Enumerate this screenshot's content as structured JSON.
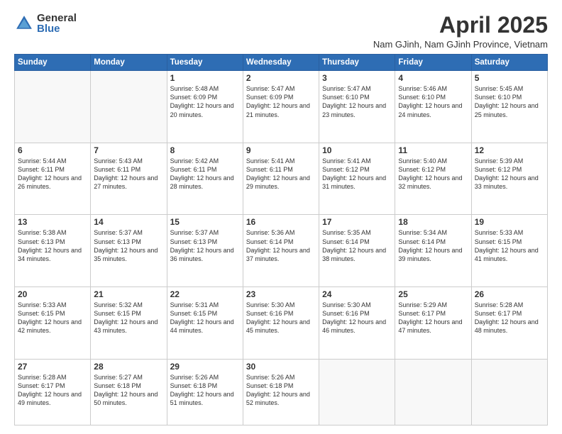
{
  "logo": {
    "general": "General",
    "blue": "Blue"
  },
  "header": {
    "title": "April 2025",
    "location": "Nam GJinh, Nam GJinh Province, Vietnam"
  },
  "weekdays": [
    "Sunday",
    "Monday",
    "Tuesday",
    "Wednesday",
    "Thursday",
    "Friday",
    "Saturday"
  ],
  "weeks": [
    [
      {
        "day": "",
        "info": ""
      },
      {
        "day": "",
        "info": ""
      },
      {
        "day": "1",
        "info": "Sunrise: 5:48 AM\nSunset: 6:09 PM\nDaylight: 12 hours and 20 minutes."
      },
      {
        "day": "2",
        "info": "Sunrise: 5:47 AM\nSunset: 6:09 PM\nDaylight: 12 hours and 21 minutes."
      },
      {
        "day": "3",
        "info": "Sunrise: 5:47 AM\nSunset: 6:10 PM\nDaylight: 12 hours and 23 minutes."
      },
      {
        "day": "4",
        "info": "Sunrise: 5:46 AM\nSunset: 6:10 PM\nDaylight: 12 hours and 24 minutes."
      },
      {
        "day": "5",
        "info": "Sunrise: 5:45 AM\nSunset: 6:10 PM\nDaylight: 12 hours and 25 minutes."
      }
    ],
    [
      {
        "day": "6",
        "info": "Sunrise: 5:44 AM\nSunset: 6:11 PM\nDaylight: 12 hours and 26 minutes."
      },
      {
        "day": "7",
        "info": "Sunrise: 5:43 AM\nSunset: 6:11 PM\nDaylight: 12 hours and 27 minutes."
      },
      {
        "day": "8",
        "info": "Sunrise: 5:42 AM\nSunset: 6:11 PM\nDaylight: 12 hours and 28 minutes."
      },
      {
        "day": "9",
        "info": "Sunrise: 5:41 AM\nSunset: 6:11 PM\nDaylight: 12 hours and 29 minutes."
      },
      {
        "day": "10",
        "info": "Sunrise: 5:41 AM\nSunset: 6:12 PM\nDaylight: 12 hours and 31 minutes."
      },
      {
        "day": "11",
        "info": "Sunrise: 5:40 AM\nSunset: 6:12 PM\nDaylight: 12 hours and 32 minutes."
      },
      {
        "day": "12",
        "info": "Sunrise: 5:39 AM\nSunset: 6:12 PM\nDaylight: 12 hours and 33 minutes."
      }
    ],
    [
      {
        "day": "13",
        "info": "Sunrise: 5:38 AM\nSunset: 6:13 PM\nDaylight: 12 hours and 34 minutes."
      },
      {
        "day": "14",
        "info": "Sunrise: 5:37 AM\nSunset: 6:13 PM\nDaylight: 12 hours and 35 minutes."
      },
      {
        "day": "15",
        "info": "Sunrise: 5:37 AM\nSunset: 6:13 PM\nDaylight: 12 hours and 36 minutes."
      },
      {
        "day": "16",
        "info": "Sunrise: 5:36 AM\nSunset: 6:14 PM\nDaylight: 12 hours and 37 minutes."
      },
      {
        "day": "17",
        "info": "Sunrise: 5:35 AM\nSunset: 6:14 PM\nDaylight: 12 hours and 38 minutes."
      },
      {
        "day": "18",
        "info": "Sunrise: 5:34 AM\nSunset: 6:14 PM\nDaylight: 12 hours and 39 minutes."
      },
      {
        "day": "19",
        "info": "Sunrise: 5:33 AM\nSunset: 6:15 PM\nDaylight: 12 hours and 41 minutes."
      }
    ],
    [
      {
        "day": "20",
        "info": "Sunrise: 5:33 AM\nSunset: 6:15 PM\nDaylight: 12 hours and 42 minutes."
      },
      {
        "day": "21",
        "info": "Sunrise: 5:32 AM\nSunset: 6:15 PM\nDaylight: 12 hours and 43 minutes."
      },
      {
        "day": "22",
        "info": "Sunrise: 5:31 AM\nSunset: 6:15 PM\nDaylight: 12 hours and 44 minutes."
      },
      {
        "day": "23",
        "info": "Sunrise: 5:30 AM\nSunset: 6:16 PM\nDaylight: 12 hours and 45 minutes."
      },
      {
        "day": "24",
        "info": "Sunrise: 5:30 AM\nSunset: 6:16 PM\nDaylight: 12 hours and 46 minutes."
      },
      {
        "day": "25",
        "info": "Sunrise: 5:29 AM\nSunset: 6:17 PM\nDaylight: 12 hours and 47 minutes."
      },
      {
        "day": "26",
        "info": "Sunrise: 5:28 AM\nSunset: 6:17 PM\nDaylight: 12 hours and 48 minutes."
      }
    ],
    [
      {
        "day": "27",
        "info": "Sunrise: 5:28 AM\nSunset: 6:17 PM\nDaylight: 12 hours and 49 minutes."
      },
      {
        "day": "28",
        "info": "Sunrise: 5:27 AM\nSunset: 6:18 PM\nDaylight: 12 hours and 50 minutes."
      },
      {
        "day": "29",
        "info": "Sunrise: 5:26 AM\nSunset: 6:18 PM\nDaylight: 12 hours and 51 minutes."
      },
      {
        "day": "30",
        "info": "Sunrise: 5:26 AM\nSunset: 6:18 PM\nDaylight: 12 hours and 52 minutes."
      },
      {
        "day": "",
        "info": ""
      },
      {
        "day": "",
        "info": ""
      },
      {
        "day": "",
        "info": ""
      }
    ]
  ]
}
